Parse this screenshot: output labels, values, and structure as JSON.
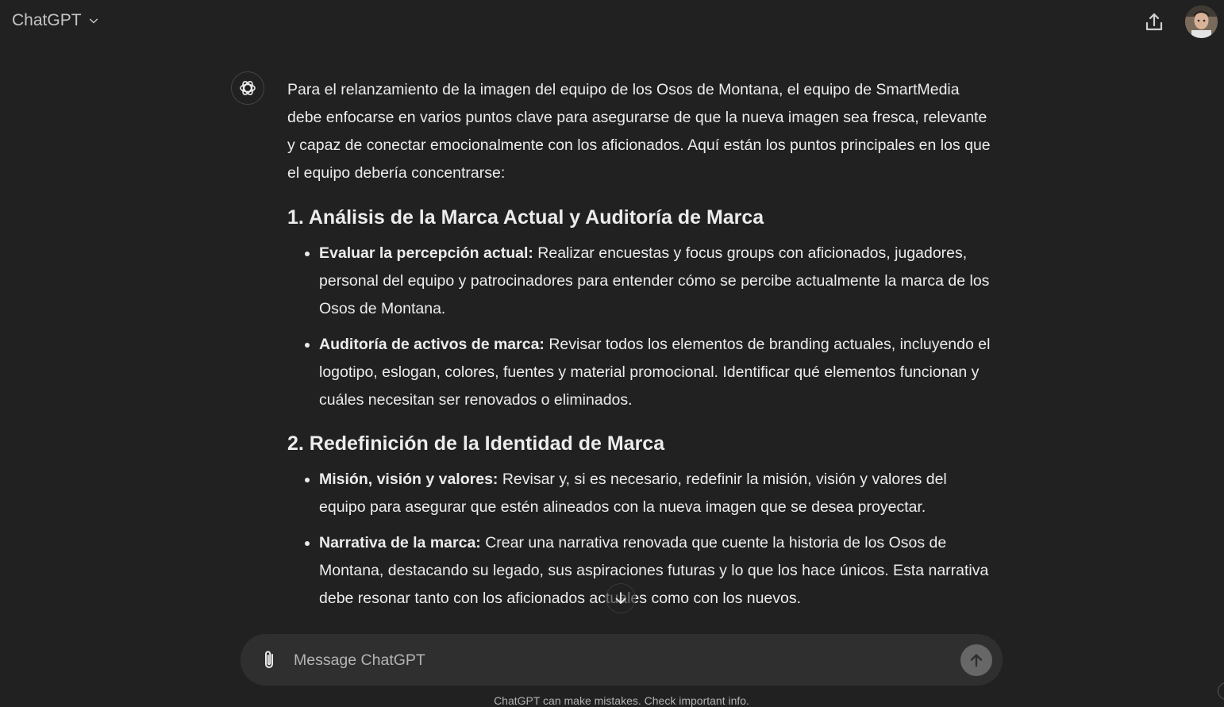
{
  "header": {
    "model_label": "ChatGPT",
    "chevron_icon": "chevron-down-icon",
    "share_icon": "share-upload-icon",
    "avatar_icon": "user-avatar"
  },
  "message": {
    "avatar_icon": "openai-logo-icon",
    "intro": "Para el relanzamiento de la imagen del equipo de los Osos de Montana, el equipo de SmartMedia debe enfocarse en varios puntos clave para asegurarse de que la nueva imagen sea fresca, relevante y capaz de conectar emocionalmente con los aficionados. Aquí están los puntos principales en los que el equipo debería concentrarse:",
    "sections": [
      {
        "heading": "1. Análisis de la Marca Actual y Auditoría de Marca",
        "items": [
          {
            "title": "Evaluar la percepción actual:",
            "text": " Realizar encuestas y focus groups con aficionados, jugadores, personal del equipo y patrocinadores para entender cómo se percibe actualmente la marca de los Osos de Montana."
          },
          {
            "title": "Auditoría de activos de marca:",
            "text": " Revisar todos los elementos de branding actuales, incluyendo el logotipo, eslogan, colores, fuentes y material promocional. Identificar qué elementos funcionan y cuáles necesitan ser renovados o eliminados."
          }
        ]
      },
      {
        "heading": "2. Redefinición de la Identidad de Marca",
        "items": [
          {
            "title": "Misión, visión y valores:",
            "text": " Revisar y, si es necesario, redefinir la misión, visión y valores del equipo para asegurar que estén alineados con la nueva imagen que se desea proyectar."
          },
          {
            "title": "Narrativa de la marca:",
            "text": " Crear una narrativa renovada que cuente la historia de los Osos de Montana, destacando su legado, sus aspiraciones futuras y lo que los hace únicos. Esta narrativa debe resonar tanto con los aficionados actuales como con los nuevos."
          }
        ]
      }
    ]
  },
  "scroll_down_icon": "arrow-down-icon",
  "composer": {
    "placeholder": "Message ChatGPT",
    "value": "",
    "attach_icon": "paperclip-icon",
    "send_icon": "arrow-up-icon"
  },
  "footer": {
    "disclaimer": "ChatGPT can make mistakes. Check important info."
  },
  "colors": {
    "background": "#212121",
    "composer": "#2f2f2f",
    "text": "#ececec",
    "muted": "#b4b4b4",
    "send_button": "#676767"
  }
}
